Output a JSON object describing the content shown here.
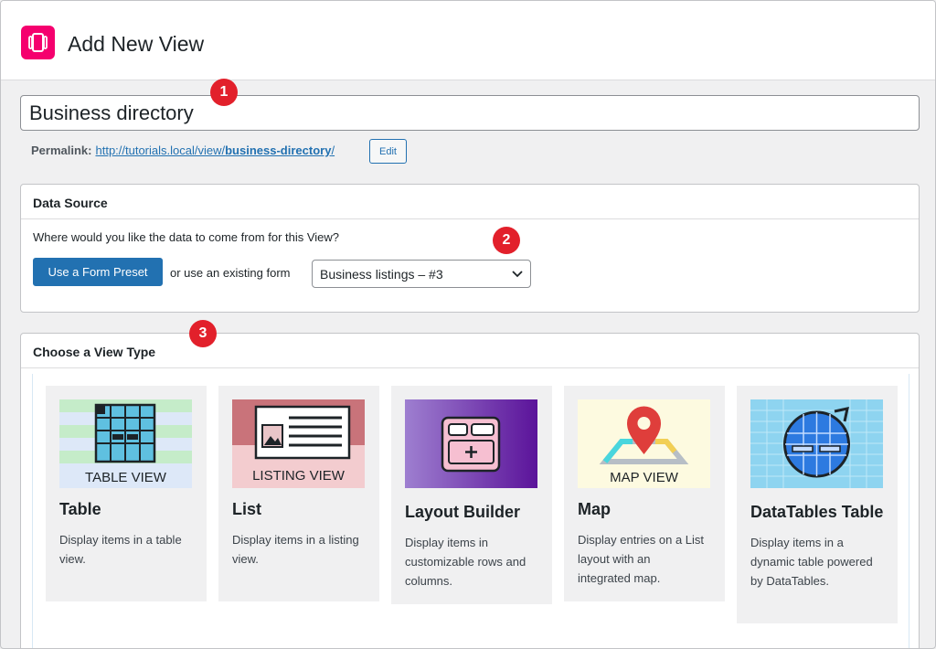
{
  "header": {
    "title": "Add New View",
    "logo_icon": "gravityview-logo-icon",
    "brand_color": "#f5006e"
  },
  "title_input": {
    "value": "Business directory"
  },
  "permalink": {
    "label": "Permalink:",
    "url_base": "http://tutorials.local/view/",
    "url_slug": "business-directory",
    "url_trailing": "/",
    "edit_label": "Edit"
  },
  "data_source": {
    "heading": "Data Source",
    "question": "Where would you like the data to come from for this View?",
    "preset_button": "Use a Form Preset",
    "or_text": "or use an existing form",
    "selected_form": "Business listings – #3"
  },
  "view_type": {
    "heading": "Choose a View Type",
    "types": [
      {
        "title": "Table",
        "description": "Display items in a table view.",
        "thumb_label": "TABLE VIEW"
      },
      {
        "title": "List",
        "description": "Display items in a listing view.",
        "thumb_label": "LISTING VIEW"
      },
      {
        "title": "Layout Builder",
        "description": "Display items in customizable rows and columns."
      },
      {
        "title": "Map",
        "description": "Display entries on a List layout with an integrated map.",
        "thumb_label": "MAP VIEW"
      },
      {
        "title": "DataTables Table",
        "description": "Display items in a dynamic table powered by DataTables."
      }
    ]
  },
  "badges": [
    "1",
    "2",
    "3"
  ],
  "colors": {
    "primary": "#2271b1",
    "badge": "#e2202b"
  }
}
